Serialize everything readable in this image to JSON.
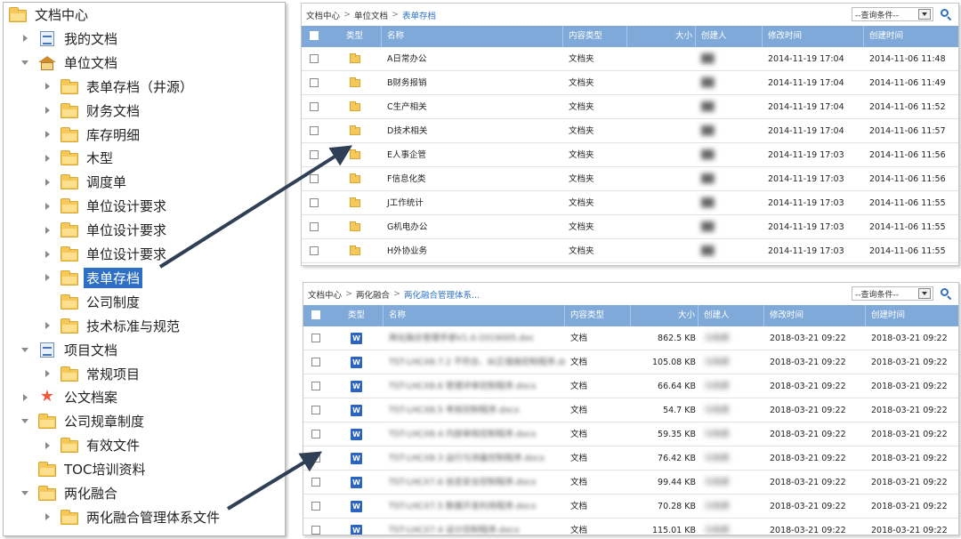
{
  "tree": {
    "items": [
      {
        "label": "文档中心",
        "icon": "folder-icon",
        "caret": "none",
        "level": 0,
        "selected": false
      },
      {
        "label": "我的文档",
        "icon": "document-icon",
        "caret": "right",
        "level": 1,
        "selected": false
      },
      {
        "label": "单位文档",
        "icon": "home-folder-icon",
        "caret": "down",
        "level": 1,
        "selected": false
      },
      {
        "label": "表单存档（井源）",
        "icon": "folder-icon",
        "caret": "right",
        "level": 2,
        "selected": false
      },
      {
        "label": "财务文档",
        "icon": "folder-icon",
        "caret": "right",
        "level": 2,
        "selected": false
      },
      {
        "label": "库存明细",
        "icon": "folder-icon",
        "caret": "right",
        "level": 2,
        "selected": false
      },
      {
        "label": "木型",
        "icon": "folder-icon",
        "caret": "right",
        "level": 2,
        "selected": false
      },
      {
        "label": "调度单",
        "icon": "folder-icon",
        "caret": "right",
        "level": 2,
        "selected": false
      },
      {
        "label": "单位设计要求",
        "icon": "folder-icon",
        "caret": "right",
        "level": 2,
        "selected": false
      },
      {
        "label": "单位设计要求",
        "icon": "folder-icon",
        "caret": "right",
        "level": 2,
        "selected": false
      },
      {
        "label": "单位设计要求",
        "icon": "folder-icon",
        "caret": "right",
        "level": 2,
        "selected": false
      },
      {
        "label": "表单存档",
        "icon": "folder-icon",
        "caret": "right",
        "level": 2,
        "selected": true
      },
      {
        "label": "公司制度",
        "icon": "folder-icon",
        "caret": "none",
        "level": 2,
        "selected": false
      },
      {
        "label": "技术标准与规范",
        "icon": "folder-icon",
        "caret": "right",
        "level": 2,
        "selected": false
      },
      {
        "label": "项目文档",
        "icon": "document-icon",
        "caret": "down",
        "level": 1,
        "selected": false
      },
      {
        "label": "常规项目",
        "icon": "folder-icon",
        "caret": "right",
        "level": 2,
        "selected": false
      },
      {
        "label": "公文档案",
        "icon": "star-folder-icon",
        "caret": "right",
        "level": 1,
        "selected": false
      },
      {
        "label": "公司规章制度",
        "icon": "folder-icon",
        "caret": "down",
        "level": 1,
        "selected": false
      },
      {
        "label": "有效文件",
        "icon": "folder-icon",
        "caret": "right",
        "level": 2,
        "selected": false
      },
      {
        "label": "TOC培训资料",
        "icon": "folder-icon",
        "caret": "none",
        "level": 1,
        "selected": false
      },
      {
        "label": "两化融合",
        "icon": "folder-icon",
        "caret": "down",
        "level": 1,
        "selected": false
      },
      {
        "label": "两化融合管理体系文件",
        "icon": "folder-icon",
        "caret": "right",
        "level": 2,
        "selected": false
      }
    ]
  },
  "top_window": {
    "breadcrumb": [
      "文档中心",
      "单位文档",
      "表单存档"
    ],
    "query_label": "--查询条件--",
    "columns": [
      "类型",
      "名称",
      "内容类型",
      "大小",
      "创建人",
      "修改时间",
      "创建时间"
    ],
    "rows": [
      {
        "name": "A日常办公",
        "content_type": "文档夹",
        "size": "",
        "creator": "██",
        "modified": "2014-11-19 17:04",
        "created": "2014-11-06 11:48"
      },
      {
        "name": "B财务报销",
        "content_type": "文档夹",
        "size": "",
        "creator": "██",
        "modified": "2014-11-19 17:04",
        "created": "2014-11-06 11:49"
      },
      {
        "name": "C生产相关",
        "content_type": "文档夹",
        "size": "",
        "creator": "██",
        "modified": "2014-11-19 17:04",
        "created": "2014-11-06 11:52"
      },
      {
        "name": "D技术相关",
        "content_type": "文档夹",
        "size": "",
        "creator": "██",
        "modified": "2014-11-19 17:04",
        "created": "2014-11-06 11:57"
      },
      {
        "name": "E人事企管",
        "content_type": "文档夹",
        "size": "",
        "creator": "██",
        "modified": "2014-11-19 17:03",
        "created": "2014-11-06 11:56"
      },
      {
        "name": "F信息化类",
        "content_type": "文档夹",
        "size": "",
        "creator": "██",
        "modified": "2014-11-19 17:03",
        "created": "2014-11-06 11:56"
      },
      {
        "name": "J工作统计",
        "content_type": "文档夹",
        "size": "",
        "creator": "██",
        "modified": "2014-11-19 17:03",
        "created": "2014-11-06 11:55"
      },
      {
        "name": "G机电办公",
        "content_type": "文档夹",
        "size": "",
        "creator": "██",
        "modified": "2014-11-19 17:03",
        "created": "2014-11-06 11:55"
      },
      {
        "name": "H外协业务",
        "content_type": "文档夹",
        "size": "",
        "creator": "██",
        "modified": "2014-11-19 17:03",
        "created": "2014-11-06 11:55"
      }
    ]
  },
  "bottom_window": {
    "breadcrumb": [
      "文档中心",
      "两化融合",
      "两化融合管理体系..."
    ],
    "query_label": "--查询条件--",
    "columns": [
      "类型",
      "名称",
      "内容类型",
      "大小",
      "创建人",
      "修改时间",
      "创建时间"
    ],
    "rows": [
      {
        "name": "两化融合管理手册V1.0-2019005.doc",
        "content_type": "文档",
        "size": "862.5 KB",
        "creator": "马晓娜",
        "modified": "2018-03-21 09:22",
        "created": "2018-03-21 09:22"
      },
      {
        "name": "TST-LHCX8.7.2 不符合、纠正措施控制程序.docx",
        "content_type": "文档",
        "size": "105.08 KB",
        "creator": "马晓娜",
        "modified": "2018-03-21 09:22",
        "created": "2018-03-21 09:22"
      },
      {
        "name": "TST-LHCX8.6 管理评审控制程序.docx",
        "content_type": "文档",
        "size": "66.64 KB",
        "creator": "马晓娜",
        "modified": "2018-03-21 09:22",
        "created": "2018-03-21 09:22"
      },
      {
        "name": "TST-LHCX8.5 考核控制程序.docx",
        "content_type": "文档",
        "size": "54.7 KB",
        "creator": "马晓娜",
        "modified": "2018-03-21 09:22",
        "created": "2018-03-21 09:22"
      },
      {
        "name": "TST-LHCX8.4 内部审核控制程序.docx",
        "content_type": "文档",
        "size": "59.35 KB",
        "creator": "马晓娜",
        "modified": "2018-03-21 09:22",
        "created": "2018-03-21 09:22"
      },
      {
        "name": "TST-LHCX8.3 运行与测量控制程序.docx",
        "content_type": "文档",
        "size": "76.42 KB",
        "creator": "马晓娜",
        "modified": "2018-03-21 09:22",
        "created": "2018-03-21 09:22"
      },
      {
        "name": "TST-LHCX7.6 信息安全控制程序.docx",
        "content_type": "文档",
        "size": "99.44 KB",
        "creator": "马晓娜",
        "modified": "2018-03-21 09:22",
        "created": "2018-03-21 09:22"
      },
      {
        "name": "TST-LHCX7.5 数据开发利用程序.docx",
        "content_type": "文档",
        "size": "70.28 KB",
        "creator": "马晓娜",
        "modified": "2018-03-21 09:22",
        "created": "2018-03-21 09:22"
      },
      {
        "name": "TST-LHCX7.4 设计控制程序.docx",
        "content_type": "文档",
        "size": "115.01 KB",
        "creator": "马晓娜",
        "modified": "2018-03-21 09:22",
        "created": "2018-03-21 09:22"
      }
    ]
  },
  "colors": {
    "header_bg": "#7ea9d9",
    "selected_bg": "#2e6fc6",
    "link": "#2f73c9",
    "folder": "#f6c85a",
    "arrow": "#2f3f55"
  }
}
